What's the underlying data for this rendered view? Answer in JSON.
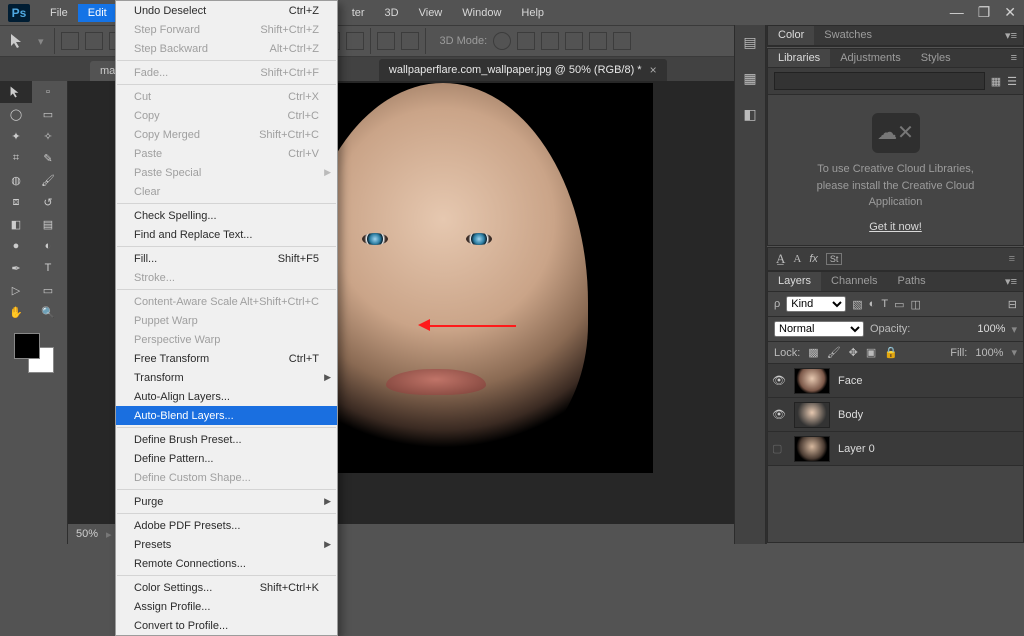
{
  "app": {
    "logo": "Ps"
  },
  "menubar": {
    "items": [
      "File",
      "Edit",
      "",
      "",
      "",
      "ter",
      "3D",
      "View",
      "Window",
      "Help"
    ],
    "openIndex": 1
  },
  "windowControls": {
    "minimize": "—",
    "maximize": "❐",
    "close": "✕"
  },
  "optionsbar": {
    "threeDMode": "3D Mode:"
  },
  "doctabs": {
    "tabs": [
      {
        "label": "mazd"
      },
      {
        "label": "wallpaperflare.com_wallpaper.jpg @ 50% (RGB/8) *"
      }
    ],
    "activeIndex": 1
  },
  "editMenu": {
    "groups": [
      [
        {
          "label": "Undo Deselect",
          "shortcut": "Ctrl+Z"
        },
        {
          "label": "Step Forward",
          "shortcut": "Shift+Ctrl+Z",
          "disabled": true
        },
        {
          "label": "Step Backward",
          "shortcut": "Alt+Ctrl+Z",
          "disabled": true
        }
      ],
      [
        {
          "label": "Fade...",
          "shortcut": "Shift+Ctrl+F",
          "disabled": true
        }
      ],
      [
        {
          "label": "Cut",
          "shortcut": "Ctrl+X",
          "disabled": true
        },
        {
          "label": "Copy",
          "shortcut": "Ctrl+C",
          "disabled": true
        },
        {
          "label": "Copy Merged",
          "shortcut": "Shift+Ctrl+C",
          "disabled": true
        },
        {
          "label": "Paste",
          "shortcut": "Ctrl+V",
          "disabled": true
        },
        {
          "label": "Paste Special",
          "submenu": true,
          "disabled": true
        },
        {
          "label": "Clear",
          "disabled": true
        }
      ],
      [
        {
          "label": "Check Spelling..."
        },
        {
          "label": "Find and Replace Text..."
        }
      ],
      [
        {
          "label": "Fill...",
          "shortcut": "Shift+F5"
        },
        {
          "label": "Stroke...",
          "disabled": true
        }
      ],
      [
        {
          "label": "Content-Aware Scale",
          "shortcut": "Alt+Shift+Ctrl+C",
          "disabled": true
        },
        {
          "label": "Puppet Warp",
          "disabled": true
        },
        {
          "label": "Perspective Warp",
          "disabled": true
        },
        {
          "label": "Free Transform",
          "shortcut": "Ctrl+T"
        },
        {
          "label": "Transform",
          "submenu": true
        },
        {
          "label": "Auto-Align Layers..."
        },
        {
          "label": "Auto-Blend Layers...",
          "highlight": true
        }
      ],
      [
        {
          "label": "Define Brush Preset..."
        },
        {
          "label": "Define Pattern..."
        },
        {
          "label": "Define Custom Shape...",
          "disabled": true
        }
      ],
      [
        {
          "label": "Purge",
          "submenu": true
        }
      ],
      [
        {
          "label": "Adobe PDF Presets..."
        },
        {
          "label": "Presets",
          "submenu": true
        },
        {
          "label": "Remote Connections..."
        }
      ],
      [
        {
          "label": "Color Settings...",
          "shortcut": "Shift+Ctrl+K"
        },
        {
          "label": "Assign Profile..."
        },
        {
          "label": "Convert to Profile..."
        }
      ]
    ]
  },
  "statusbar": {
    "zoom": "50%"
  },
  "panels": {
    "color": {
      "tabs": [
        "Color",
        "Swatches"
      ],
      "active": 0
    },
    "libraries": {
      "tabs": [
        "Libraries",
        "Adjustments",
        "Styles"
      ],
      "active": 0,
      "emptyTitle": "To use Creative Cloud Libraries, please install the Creative Cloud Application",
      "emptyLine1": "To use Creative Cloud Libraries,",
      "emptyLine2": "please install the Creative Cloud",
      "emptyLine3": "Application",
      "cta": "Get it now!"
    },
    "character": {
      "font": "A",
      "fx": "fx",
      "st": "St"
    },
    "layers": {
      "tabs": [
        "Layers",
        "Channels",
        "Paths"
      ],
      "active": 0,
      "kindLabel": "Kind",
      "blendMode": "Normal",
      "opacityLabel": "Opacity:",
      "opacityValue": "100%",
      "lockLabel": "Lock:",
      "fillLabel": "Fill:",
      "fillValue": "100%",
      "layers": [
        {
          "name": "Face",
          "visible": true,
          "thumb": "face-t"
        },
        {
          "name": "Body",
          "visible": true,
          "thumb": "body-t"
        },
        {
          "name": "Layer 0",
          "visible": false,
          "thumb": "zero-t",
          "locked": false
        }
      ]
    }
  }
}
